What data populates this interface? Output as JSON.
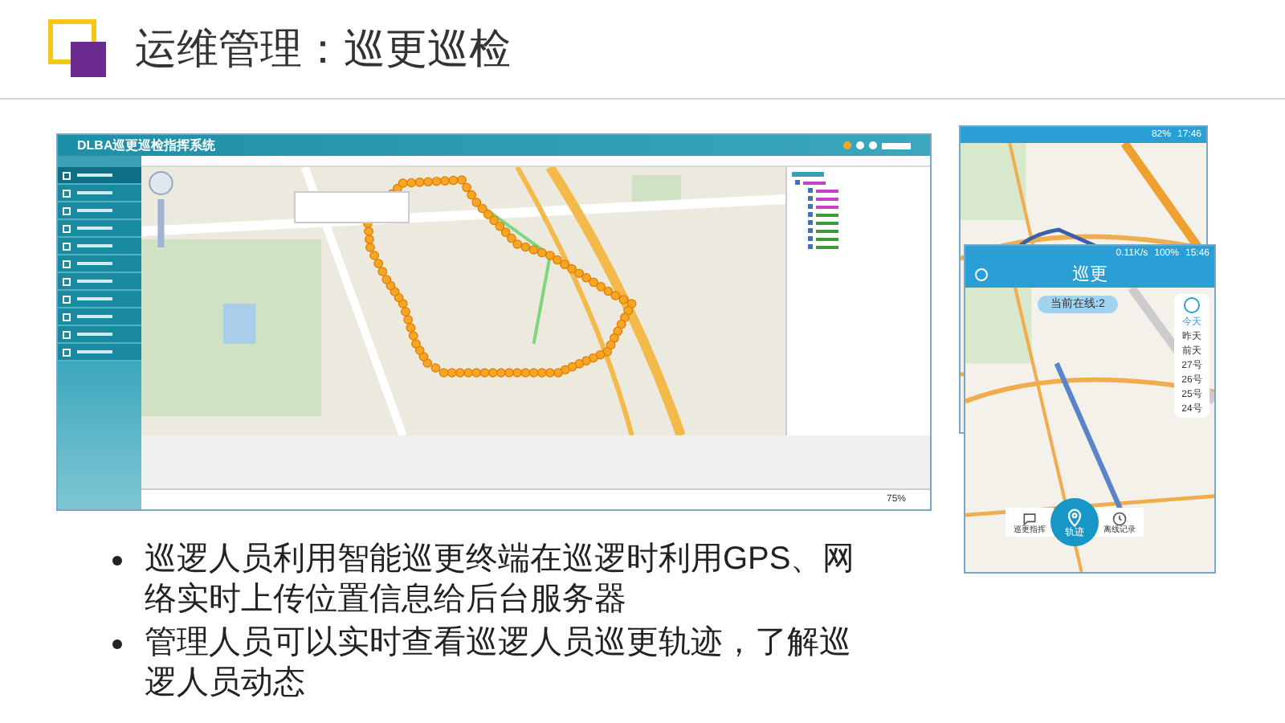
{
  "slide": {
    "title": "运维管理：巡更巡检"
  },
  "desktop_app": {
    "title": "DLBA巡更巡检指挥系统",
    "sidebar_items": [
      {
        "selected": true
      },
      {
        "selected": false
      },
      {
        "selected": false
      },
      {
        "selected": false
      },
      {
        "selected": false
      },
      {
        "selected": false
      },
      {
        "selected": false
      },
      {
        "selected": false
      },
      {
        "selected": false
      },
      {
        "selected": false
      },
      {
        "selected": false
      }
    ],
    "zoom": "75%"
  },
  "mobile_back": {
    "battery": "82%",
    "time": "17:46"
  },
  "mobile_front": {
    "speed": "0.11K/s",
    "battery": "100%",
    "time": "15:46",
    "title": "巡更",
    "online": "当前在线:2",
    "days": [
      {
        "label": "今天",
        "selected": true
      },
      {
        "label": "昨天",
        "selected": false
      },
      {
        "label": "前天",
        "selected": false
      },
      {
        "label": "27号",
        "selected": false
      },
      {
        "label": "26号",
        "selected": false
      },
      {
        "label": "25号",
        "selected": false
      },
      {
        "label": "24号",
        "selected": false
      }
    ],
    "actions": [
      {
        "label": "巡更指挥",
        "kind": "chat"
      },
      {
        "label": "轨迹",
        "kind": "track"
      },
      {
        "label": "离线记录",
        "kind": "history"
      }
    ]
  },
  "bullets": [
    "巡逻人员利用智能巡更终端在巡逻时利用GPS、网络实时上传位置信息给后台服务器",
    "管理人员可以实时查看巡逻人员巡更轨迹，了解巡逻人员动态"
  ]
}
